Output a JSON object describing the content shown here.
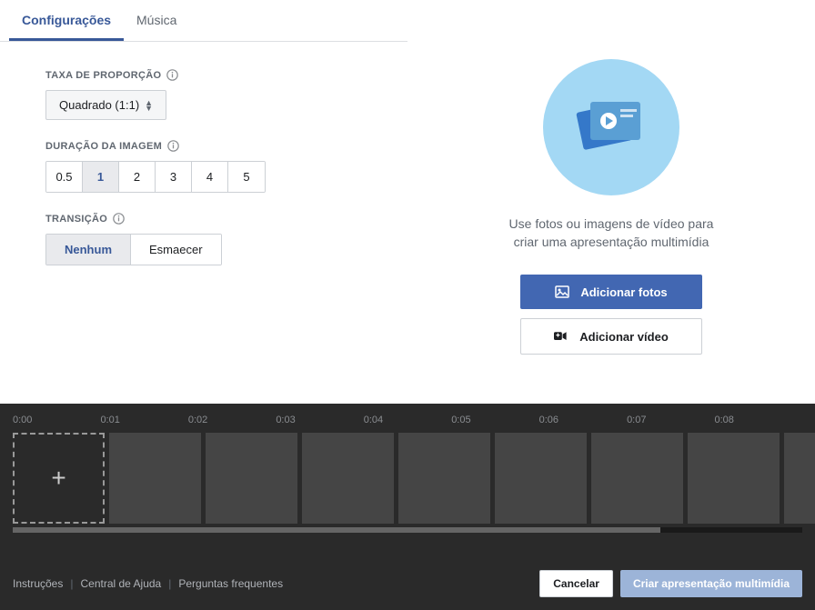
{
  "tabs": {
    "settings": "Configurações",
    "music": "Música"
  },
  "settings": {
    "aspect_ratio": {
      "label": "TAXA DE PROPORÇÃO",
      "value": "Quadrado (1:1)"
    },
    "image_duration": {
      "label": "DURAÇÃO DA IMAGEM",
      "options": [
        "0.5",
        "1",
        "2",
        "3",
        "4",
        "5"
      ],
      "selected": "1"
    },
    "transition": {
      "label": "TRANSIÇÃO",
      "options": [
        "Nenhum",
        "Esmaecer"
      ],
      "selected": "Nenhum"
    }
  },
  "preview": {
    "helper_text_line1": "Use fotos ou imagens de vídeo para",
    "helper_text_line2": "criar uma apresentação multimídia",
    "add_photos": "Adicionar fotos",
    "add_video": "Adicionar vídeo"
  },
  "timeline": {
    "marks": [
      "0:00",
      "0:01",
      "0:02",
      "0:03",
      "0:04",
      "0:05",
      "0:06",
      "0:07",
      "0:08"
    ]
  },
  "footer": {
    "instructions": "Instruções",
    "help_center": "Central de Ajuda",
    "faq": "Perguntas frequentes",
    "cancel": "Cancelar",
    "create": "Criar apresentação multimídia"
  }
}
